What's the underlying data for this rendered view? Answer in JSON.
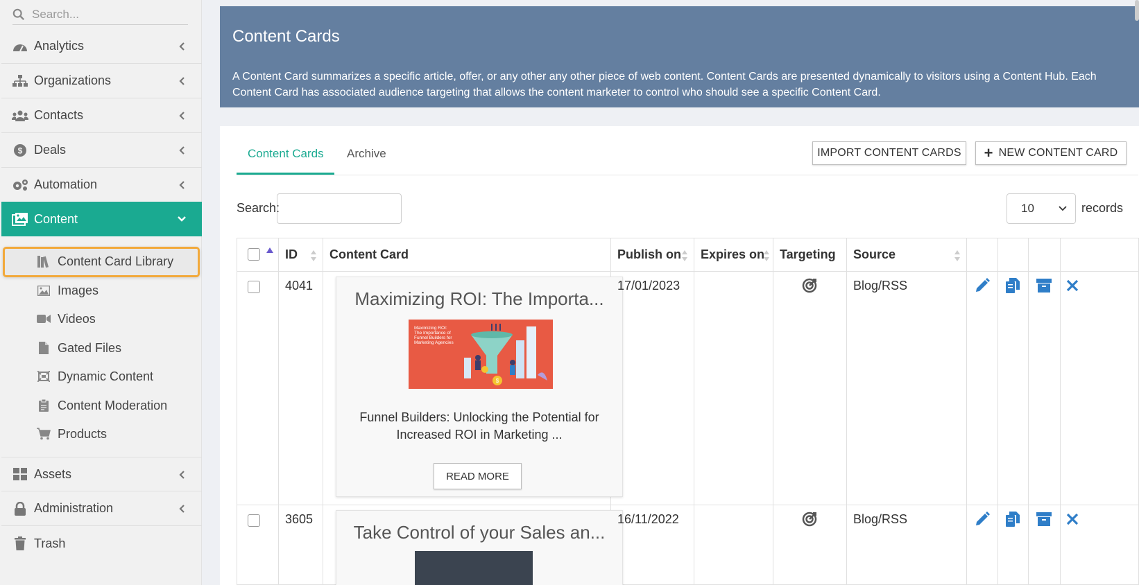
{
  "sidebar": {
    "search_placeholder": "Search...",
    "items": [
      {
        "label": "Analytics",
        "icon": "gauge-icon"
      },
      {
        "label": "Organizations",
        "icon": "sitemap-icon"
      },
      {
        "label": "Contacts",
        "icon": "users-icon"
      },
      {
        "label": "Deals",
        "icon": "dollar-icon"
      },
      {
        "label": "Automation",
        "icon": "cogs-icon"
      },
      {
        "label": "Content",
        "icon": "content-icon"
      },
      {
        "label": "Assets",
        "icon": "grid-icon"
      },
      {
        "label": "Administration",
        "icon": "lock-icon"
      },
      {
        "label": "Trash",
        "icon": "trash-icon"
      }
    ],
    "content_sub": [
      {
        "label": "Content Card Library",
        "icon": "books-icon"
      },
      {
        "label": "Images",
        "icon": "image-icon"
      },
      {
        "label": "Videos",
        "icon": "video-icon"
      },
      {
        "label": "Gated Files",
        "icon": "file-icon"
      },
      {
        "label": "Dynamic Content",
        "icon": "dynamic-icon"
      },
      {
        "label": "Content Moderation",
        "icon": "clipboard-icon"
      },
      {
        "label": "Products",
        "icon": "cart-icon"
      }
    ]
  },
  "header": {
    "title": "Content Cards",
    "description": "A Content Card summarizes a specific article, offer, or any other any other piece of web content. Content Cards are presented dynamically to visitors using a Content Hub. Each Content Card has associated audience targeting that allows the content marketer to control who should see a specific Content Card."
  },
  "tabs": {
    "content_cards": "Content Cards",
    "archive": "Archive"
  },
  "buttons": {
    "import": "IMPORT CONTENT CARDS",
    "new": "NEW CONTENT CARD"
  },
  "search": {
    "label": "Search:",
    "value": ""
  },
  "records": {
    "value": "10",
    "label": "records"
  },
  "table": {
    "columns": {
      "id": "ID",
      "card": "Content Card",
      "publish": "Publish on",
      "expires": "Expires on",
      "targeting": "Targeting",
      "source": "Source"
    },
    "rows": [
      {
        "id": "4041",
        "title": "Maximizing ROI: The Importa...",
        "image_text": "Maximizing ROI: The Importance of Funnel Builders for Marketing Agencies",
        "description": "Funnel Builders: Unlocking the Potential for Increased ROI in Marketing ...",
        "read_more": "READ MORE",
        "publish": "17/01/2023",
        "expires": "",
        "source": "Blog/RSS"
      },
      {
        "id": "3605",
        "title": "Take Control of your Sales an...",
        "publish": "16/11/2022",
        "expires": "",
        "source": "Blog/RSS"
      }
    ]
  },
  "colors": {
    "accent": "#1aaa91",
    "banner": "#647fa0",
    "action_blue": "#2f7ec8",
    "highlight": "#f2a93b"
  }
}
